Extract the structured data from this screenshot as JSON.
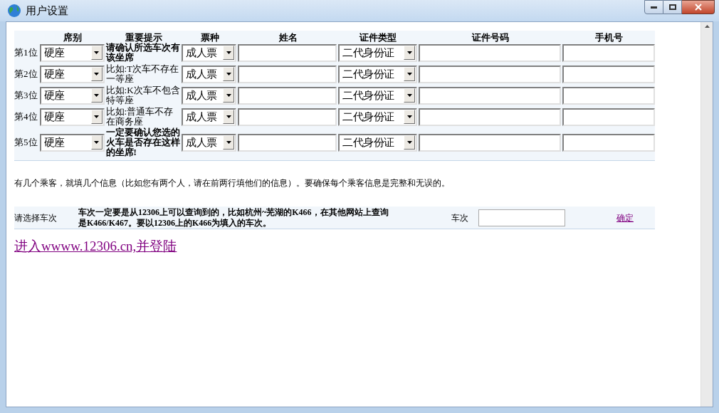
{
  "window": {
    "title": "用户设置"
  },
  "table": {
    "columns": [
      "席别",
      "重要提示",
      "票种",
      "姓名",
      "证件类型",
      "证件号码",
      "手机号"
    ],
    "rows": [
      {
        "label": "第1位",
        "seat": "硬座",
        "hint": "请确认所选车次有该坐席",
        "hint_bold": true,
        "ticket": "成人票",
        "id_type": "二代身份证"
      },
      {
        "label": "第2位",
        "seat": "硬座",
        "hint": "比如:T次车不存在一等座",
        "hint_bold": false,
        "ticket": "成人票",
        "id_type": "二代身份证"
      },
      {
        "label": "第3位",
        "seat": "硬座",
        "hint": "比如:K次车不包含特等座",
        "hint_bold": false,
        "ticket": "成人票",
        "id_type": "二代身份证"
      },
      {
        "label": "第4位",
        "seat": "硬座",
        "hint": "比如:普通车不存在商务座",
        "hint_bold": false,
        "ticket": "成人票",
        "id_type": "二代身份证"
      },
      {
        "label": "第5位",
        "seat": "硬座",
        "hint": "一定要确认您选的火车是否存在这样的坐席!",
        "hint_bold": true,
        "ticket": "成人票",
        "id_type": "二代身份证"
      }
    ]
  },
  "note": "有几个乘客，就填几个信息（比如您有两个人，请在前两行填他们的信息）。要确保每个乘客信息是完整和无误的。",
  "train": {
    "label": "请选择车次",
    "description": "车次一定要是从12306上可以查询到的，比如杭州~芜湖的K466，在其他网站上查询是K466/K467。要以12306上的K466为填入的车次。",
    "field_label": "车次",
    "confirm": "确定"
  },
  "login_link": "进入wwww.12306.cn,并登陆"
}
